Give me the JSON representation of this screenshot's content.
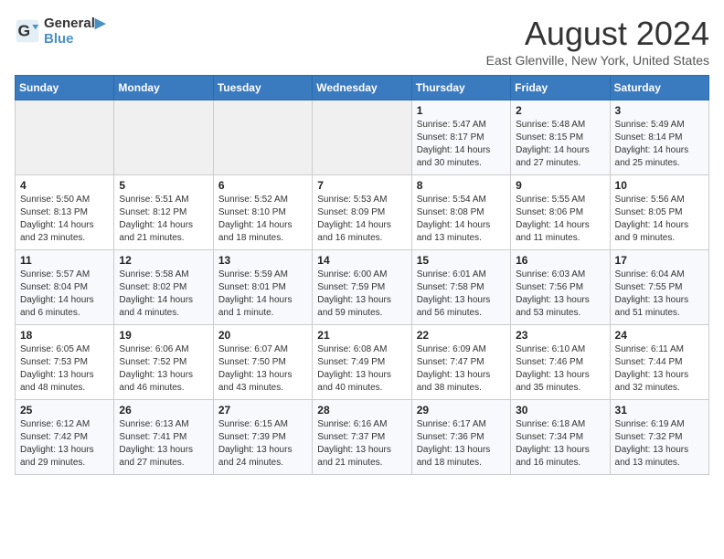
{
  "logo": {
    "line1": "General",
    "line2": "Blue"
  },
  "title": "August 2024",
  "subtitle": "East Glenville, New York, United States",
  "days_of_week": [
    "Sunday",
    "Monday",
    "Tuesday",
    "Wednesday",
    "Thursday",
    "Friday",
    "Saturday"
  ],
  "weeks": [
    [
      {
        "day": "",
        "detail": ""
      },
      {
        "day": "",
        "detail": ""
      },
      {
        "day": "",
        "detail": ""
      },
      {
        "day": "",
        "detail": ""
      },
      {
        "day": "1",
        "detail": "Sunrise: 5:47 AM\nSunset: 8:17 PM\nDaylight: 14 hours\nand 30 minutes."
      },
      {
        "day": "2",
        "detail": "Sunrise: 5:48 AM\nSunset: 8:15 PM\nDaylight: 14 hours\nand 27 minutes."
      },
      {
        "day": "3",
        "detail": "Sunrise: 5:49 AM\nSunset: 8:14 PM\nDaylight: 14 hours\nand 25 minutes."
      }
    ],
    [
      {
        "day": "4",
        "detail": "Sunrise: 5:50 AM\nSunset: 8:13 PM\nDaylight: 14 hours\nand 23 minutes."
      },
      {
        "day": "5",
        "detail": "Sunrise: 5:51 AM\nSunset: 8:12 PM\nDaylight: 14 hours\nand 21 minutes."
      },
      {
        "day": "6",
        "detail": "Sunrise: 5:52 AM\nSunset: 8:10 PM\nDaylight: 14 hours\nand 18 minutes."
      },
      {
        "day": "7",
        "detail": "Sunrise: 5:53 AM\nSunset: 8:09 PM\nDaylight: 14 hours\nand 16 minutes."
      },
      {
        "day": "8",
        "detail": "Sunrise: 5:54 AM\nSunset: 8:08 PM\nDaylight: 14 hours\nand 13 minutes."
      },
      {
        "day": "9",
        "detail": "Sunrise: 5:55 AM\nSunset: 8:06 PM\nDaylight: 14 hours\nand 11 minutes."
      },
      {
        "day": "10",
        "detail": "Sunrise: 5:56 AM\nSunset: 8:05 PM\nDaylight: 14 hours\nand 9 minutes."
      }
    ],
    [
      {
        "day": "11",
        "detail": "Sunrise: 5:57 AM\nSunset: 8:04 PM\nDaylight: 14 hours\nand 6 minutes."
      },
      {
        "day": "12",
        "detail": "Sunrise: 5:58 AM\nSunset: 8:02 PM\nDaylight: 14 hours\nand 4 minutes."
      },
      {
        "day": "13",
        "detail": "Sunrise: 5:59 AM\nSunset: 8:01 PM\nDaylight: 14 hours\nand 1 minute."
      },
      {
        "day": "14",
        "detail": "Sunrise: 6:00 AM\nSunset: 7:59 PM\nDaylight: 13 hours\nand 59 minutes."
      },
      {
        "day": "15",
        "detail": "Sunrise: 6:01 AM\nSunset: 7:58 PM\nDaylight: 13 hours\nand 56 minutes."
      },
      {
        "day": "16",
        "detail": "Sunrise: 6:03 AM\nSunset: 7:56 PM\nDaylight: 13 hours\nand 53 minutes."
      },
      {
        "day": "17",
        "detail": "Sunrise: 6:04 AM\nSunset: 7:55 PM\nDaylight: 13 hours\nand 51 minutes."
      }
    ],
    [
      {
        "day": "18",
        "detail": "Sunrise: 6:05 AM\nSunset: 7:53 PM\nDaylight: 13 hours\nand 48 minutes."
      },
      {
        "day": "19",
        "detail": "Sunrise: 6:06 AM\nSunset: 7:52 PM\nDaylight: 13 hours\nand 46 minutes."
      },
      {
        "day": "20",
        "detail": "Sunrise: 6:07 AM\nSunset: 7:50 PM\nDaylight: 13 hours\nand 43 minutes."
      },
      {
        "day": "21",
        "detail": "Sunrise: 6:08 AM\nSunset: 7:49 PM\nDaylight: 13 hours\nand 40 minutes."
      },
      {
        "day": "22",
        "detail": "Sunrise: 6:09 AM\nSunset: 7:47 PM\nDaylight: 13 hours\nand 38 minutes."
      },
      {
        "day": "23",
        "detail": "Sunrise: 6:10 AM\nSunset: 7:46 PM\nDaylight: 13 hours\nand 35 minutes."
      },
      {
        "day": "24",
        "detail": "Sunrise: 6:11 AM\nSunset: 7:44 PM\nDaylight: 13 hours\nand 32 minutes."
      }
    ],
    [
      {
        "day": "25",
        "detail": "Sunrise: 6:12 AM\nSunset: 7:42 PM\nDaylight: 13 hours\nand 29 minutes."
      },
      {
        "day": "26",
        "detail": "Sunrise: 6:13 AM\nSunset: 7:41 PM\nDaylight: 13 hours\nand 27 minutes."
      },
      {
        "day": "27",
        "detail": "Sunrise: 6:15 AM\nSunset: 7:39 PM\nDaylight: 13 hours\nand 24 minutes."
      },
      {
        "day": "28",
        "detail": "Sunrise: 6:16 AM\nSunset: 7:37 PM\nDaylight: 13 hours\nand 21 minutes."
      },
      {
        "day": "29",
        "detail": "Sunrise: 6:17 AM\nSunset: 7:36 PM\nDaylight: 13 hours\nand 18 minutes."
      },
      {
        "day": "30",
        "detail": "Sunrise: 6:18 AM\nSunset: 7:34 PM\nDaylight: 13 hours\nand 16 minutes."
      },
      {
        "day": "31",
        "detail": "Sunrise: 6:19 AM\nSunset: 7:32 PM\nDaylight: 13 hours\nand 13 minutes."
      }
    ]
  ]
}
